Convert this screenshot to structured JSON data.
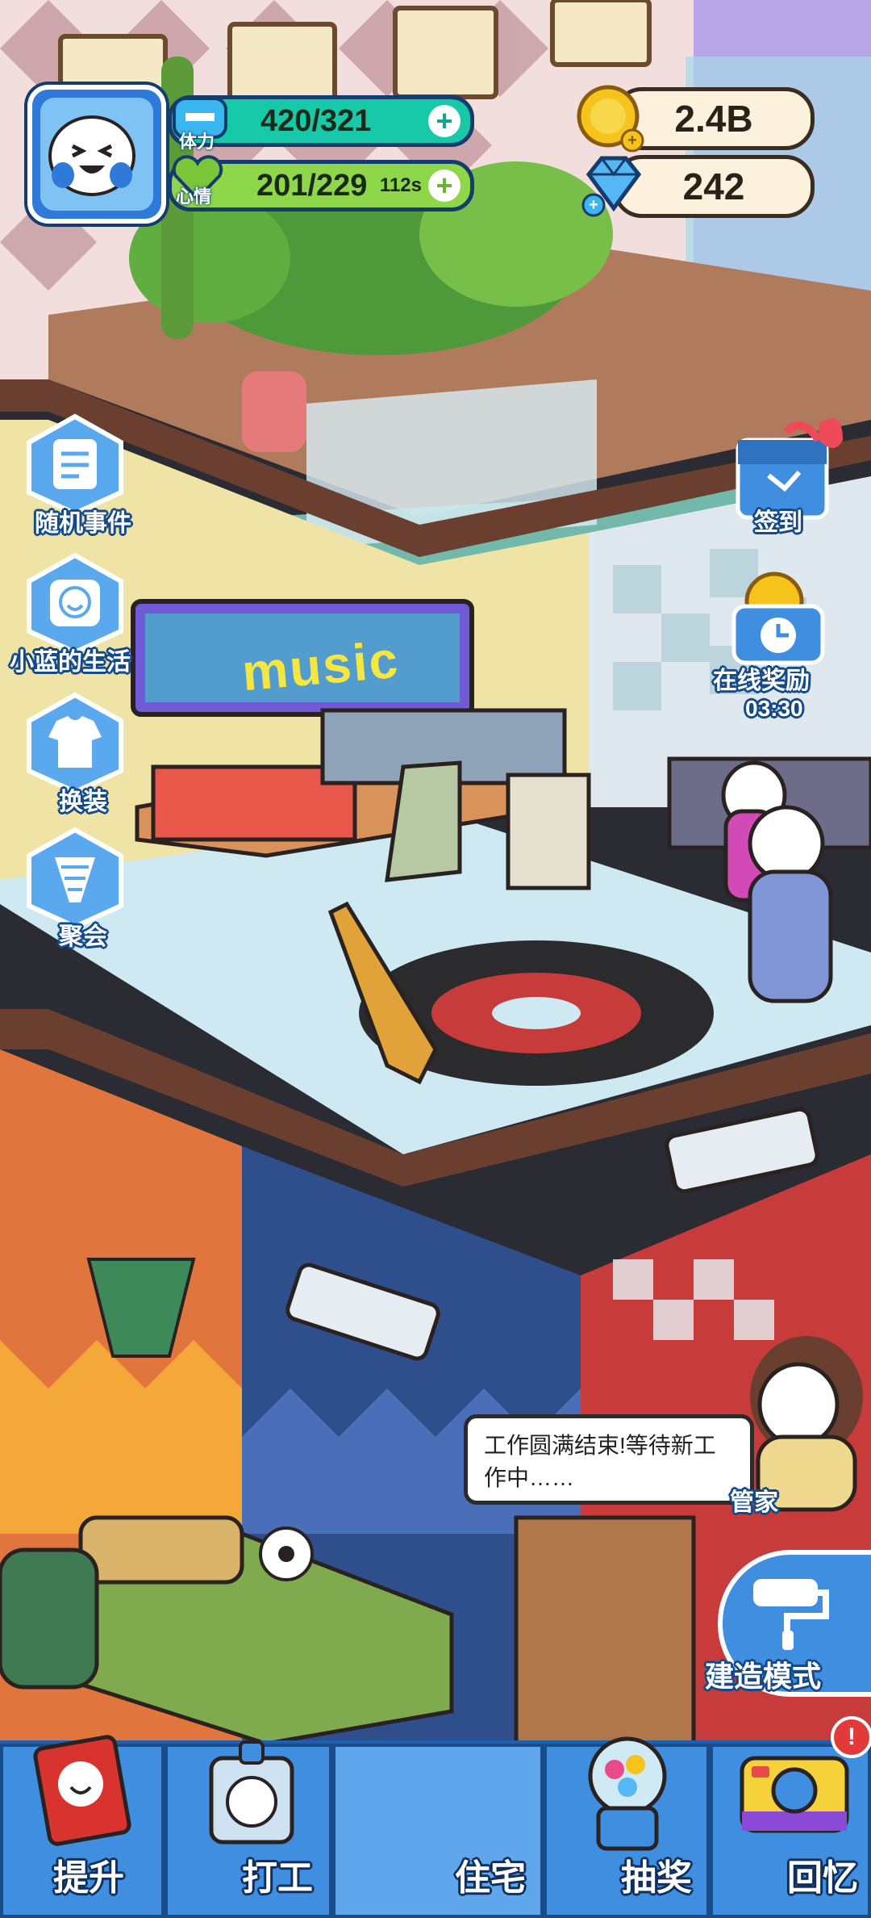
{
  "hud": {
    "stamina_label": "体力",
    "stamina_value": "420/321",
    "mood_label": "心情",
    "mood_value": "201/229",
    "mood_timer": "112s",
    "coins": "2.4B",
    "gems": "242",
    "plus_symbol": "+"
  },
  "side_left": [
    {
      "label": "随机事件",
      "icon": "event-note-icon"
    },
    {
      "label": "小蓝的生活",
      "icon": "face-icon"
    },
    {
      "label": "换装",
      "icon": "shirt-icon"
    },
    {
      "label": "聚会",
      "icon": "party-popper-icon"
    }
  ],
  "side_right": {
    "signin_label": "签到",
    "online_reward_label": "在线奖励",
    "online_reward_timer": "03:30"
  },
  "scene": {
    "music_sign": "music",
    "butler_label": "管家",
    "bubble_text": "工作圆满结束!等待新工作中……",
    "build_mode_label": "建造模式"
  },
  "bottom_nav": [
    {
      "label": "提升",
      "icon": "book-icon"
    },
    {
      "label": "打工",
      "icon": "badge-icon"
    },
    {
      "label": "住宅",
      "icon": "house-icon"
    },
    {
      "label": "抽奖",
      "icon": "gacha-icon"
    },
    {
      "label": "回忆",
      "icon": "camera-icon"
    }
  ],
  "badges": {
    "memories_alert": "!"
  },
  "colors": {
    "stamina_bar": "#17c9a8",
    "mood_bar": "#8ed64a",
    "nav_blue": "#3f8ee0",
    "nav_dark": "#1e5fae",
    "coin": "#f5c31c",
    "gem": "#56b7f5"
  }
}
